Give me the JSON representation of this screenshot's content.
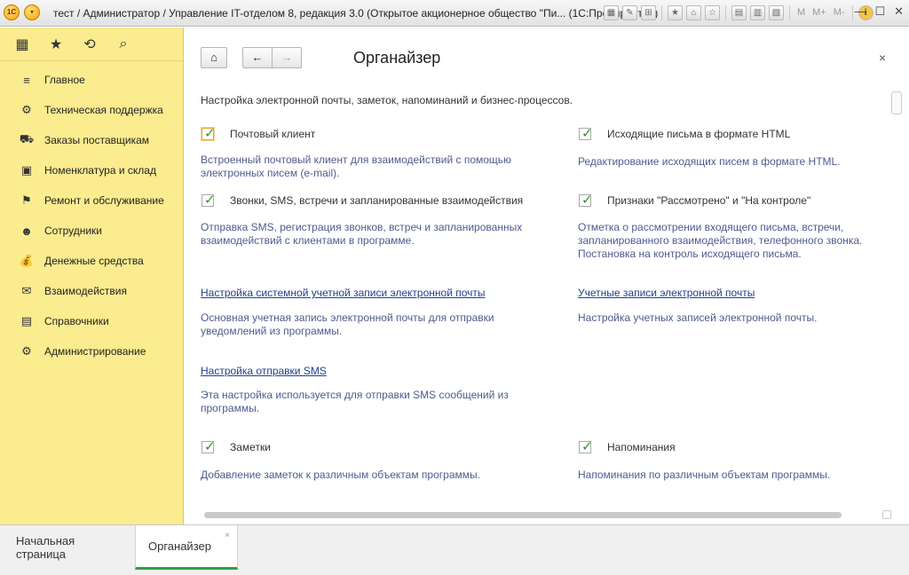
{
  "window": {
    "title": "тест / Администратор / Управление IT-отделом 8, редакция 3.0 (Открытое акционерное общество \"Пи... (1С:Предприятие)",
    "logo_text": "1С",
    "menu_glyph": "▾",
    "toolbar": [
      "▦",
      "✎",
      "⊞",
      "★",
      "⌂",
      "☆",
      "▤",
      "▥",
      "▧"
    ],
    "memory_buttons": [
      "M",
      "M+",
      "M-"
    ],
    "info_glyph": "i",
    "controls": {
      "minimize": "—",
      "maximize": "☐",
      "close": "✕"
    }
  },
  "sidebar": {
    "top_icons": [
      "▦",
      "★",
      "⟲",
      "⌕"
    ],
    "items": [
      {
        "label": "Главное",
        "icon": "≡"
      },
      {
        "label": "Техническая поддержка",
        "icon": "⚙"
      },
      {
        "label": "Заказы поставщикам",
        "icon": "⛟"
      },
      {
        "label": "Номенклатура и склад",
        "icon": "▣"
      },
      {
        "label": "Ремонт и обслуживание",
        "icon": "⚑"
      },
      {
        "label": "Сотрудники",
        "icon": "☻"
      },
      {
        "label": "Денежные средства",
        "icon": "💰"
      },
      {
        "label": "Взаимодействия",
        "icon": "✉"
      },
      {
        "label": "Справочники",
        "icon": "▤"
      },
      {
        "label": "Администрирование",
        "icon": "⚙"
      }
    ]
  },
  "content": {
    "nav": {
      "home": "⌂",
      "back": "←",
      "forward": "→",
      "close": "×"
    },
    "title": "Органайзер",
    "subtitle": "Настройка электронной почты, заметок, напоминаний и бизнес-процессов.",
    "options": {
      "mail_client": {
        "label": "Почтовый клиент",
        "checked": true,
        "desc": [
          "Встроенный почтовый клиент для взаимодействий с помощью",
          "электронных писем (e-mail)."
        ]
      },
      "html_mail": {
        "label": "Исходящие письма в формате HTML",
        "checked": true,
        "desc": [
          "Редактирование исходящих писем в формате HTML."
        ]
      },
      "calls": {
        "label": "Звонки, SMS, встречи и запланированные взаимодействия",
        "checked": true,
        "desc": [
          "Отправка SMS, регистрация звонков, встреч и запланированных",
          "взаимодействий с клиентами в программе."
        ]
      },
      "reviewed": {
        "label": "Признаки \"Рассмотрено\" и \"На контроле\"",
        "checked": true,
        "desc": [
          "Отметка о рассмотрении входящего письма, встречи,",
          "запланированного взаимодействия, телефонного звонка.",
          "Постановка на контроль исходящего письма."
        ]
      },
      "notes": {
        "label": "Заметки",
        "checked": true,
        "desc": [
          "Добавление заметок к различным объектам программы."
        ]
      },
      "reminders": {
        "label": "Напоминания",
        "checked": true,
        "desc": [
          "Напоминания по различным объектам программы."
        ]
      }
    },
    "links": {
      "system_account": {
        "label": "Настройка системной учетной записи электронной почты",
        "desc": [
          "Основная учетная запись электронной почты для отправки",
          "уведомлений из программы."
        ]
      },
      "accounts": {
        "label": "Учетные записи электронной почты",
        "desc": [
          "Настройка учетных записей электронной почты."
        ]
      },
      "sms": {
        "label": "Настройка отправки SMS",
        "desc": [
          "Эта настройка используется для отправки SMS сообщений из",
          "программы."
        ]
      }
    }
  },
  "tabs": [
    {
      "label": "Начальная страница",
      "active": false
    },
    {
      "label": "Органайзер",
      "active": true,
      "close": "×"
    }
  ],
  "colors": {
    "sidebar_bg": "#fbec8f",
    "checkmark": "#2a9a2a",
    "link": "#1f3f8f",
    "desc": "#4e5b8e",
    "active_tab": "#2e9f44"
  }
}
